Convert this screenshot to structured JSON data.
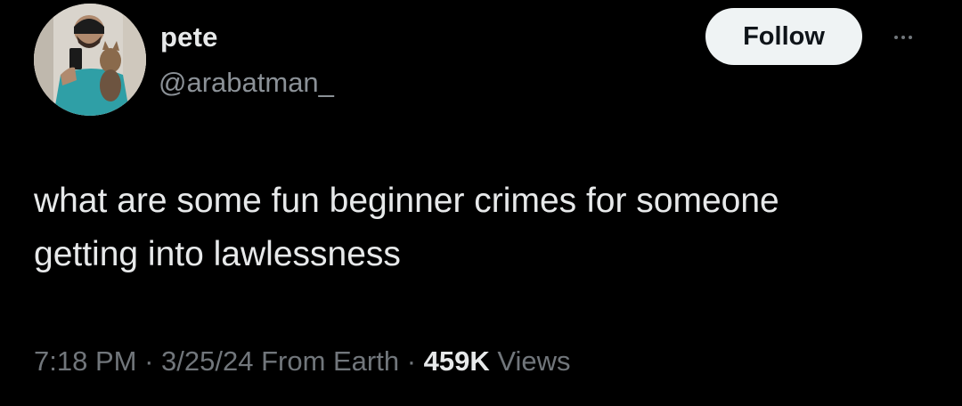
{
  "user": {
    "display_name": "pete",
    "handle": "@arabatman_"
  },
  "follow_button": {
    "label": "Follow"
  },
  "tweet": {
    "line1": "what are some fun beginner crimes for someone",
    "line2": "getting into lawlessness"
  },
  "meta": {
    "time": "7:18 PM",
    "sep1": " · ",
    "date": "3/25/24",
    "source": " From Earth",
    "sep2": " · ",
    "views_count": "459K",
    "views_label": " Views"
  },
  "icons": {
    "more": "more-horizontal-icon",
    "avatar": "profile-photo"
  },
  "colors": {
    "background": "#000000",
    "text_primary": "#e7e9ea",
    "text_secondary": "#71767b",
    "button_bg": "#eff3f4",
    "button_text": "#0f1419"
  }
}
